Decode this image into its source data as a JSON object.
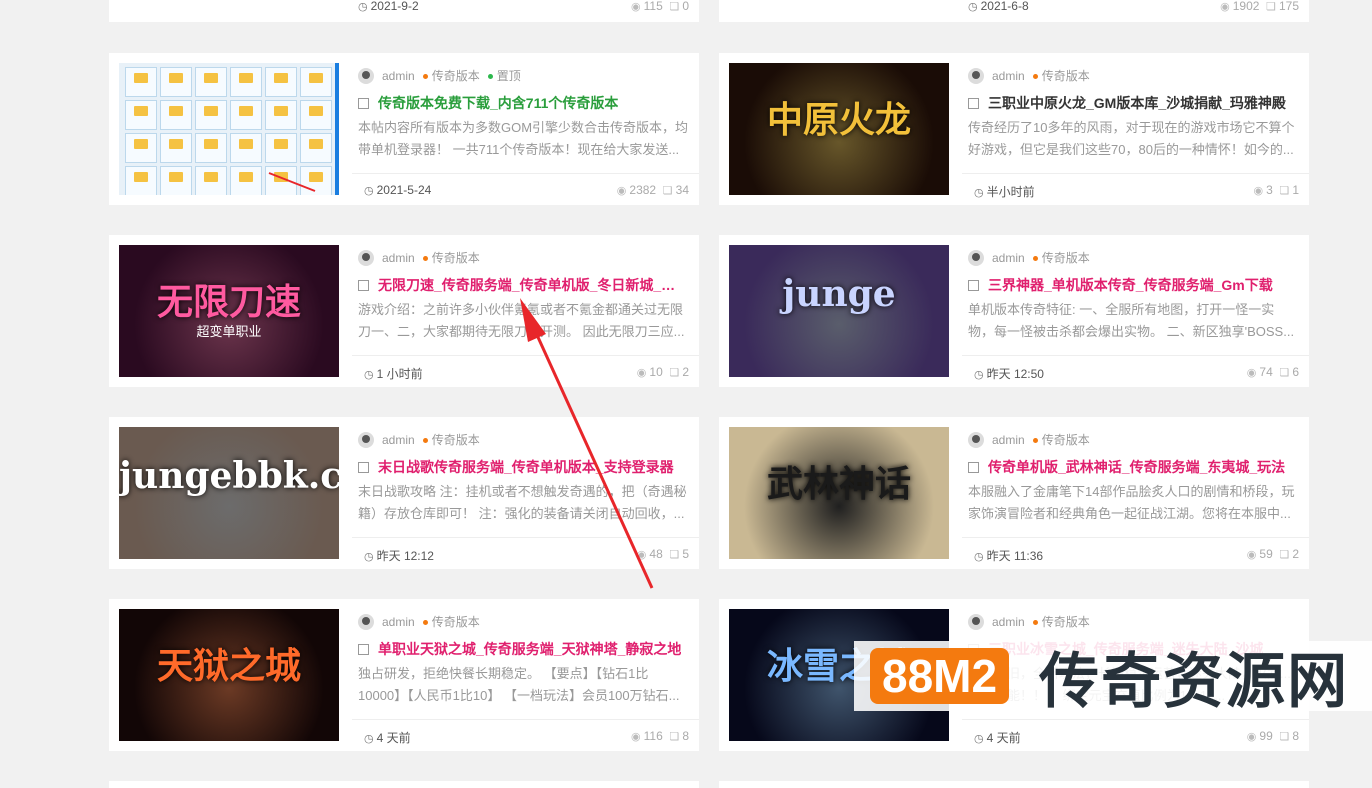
{
  "top_row": [
    {
      "date": "2021-9-2",
      "views": "115",
      "comments": "0"
    },
    {
      "date": "2021-6-8",
      "views": "1902",
      "comments": "175"
    }
  ],
  "posts": [
    {
      "author": "admin",
      "category": "传奇版本",
      "tag": "置顶",
      "tag_color": "#2db84d",
      "title": "传奇版本免费下载_内含711个传奇版本",
      "title_color": "#2a9e3c",
      "excerpt": "本帖内容所有版本为多数GOM引擎少数合击传奇版本，均带单机登录器！ 一共711个传奇版本！现在给大家发送...",
      "date": "2021-5-24",
      "views": "2382",
      "comments": "34",
      "thumb": "folders"
    },
    {
      "author": "admin",
      "category": "传奇版本",
      "title": "三职业中原火龙_GM版本库_沙城捐献_玛雅神殿",
      "title_color": "#333333",
      "excerpt": "传奇经历了10多年的风雨，对于现在的游戏市场它不算个好游戏，但它是我们这些70，80后的一种情怀！如今的...",
      "date": "半小时前",
      "views": "3",
      "comments": "1",
      "thumb_text": "中原火龙",
      "thumb_bg": "#1a0c06",
      "thumb_color": "#f2c03a"
    },
    {
      "author": "admin",
      "category": "传奇版本",
      "title": "无限刀速_传奇服务端_传奇单机版_冬日新城_单职业",
      "title_color": "#e0206e",
      "excerpt": "游戏介绍：之前许多小伙伴氪氪或者不氪金都通关过无限刀一、二，大家都期待无限刀三开测。 因此无限刀三应...",
      "date": "1 小时前",
      "views": "10",
      "comments": "2",
      "thumb_text": "无限刀速",
      "thumb_sub": "超变单职业",
      "thumb_bg": "#2a0a20",
      "thumb_color": "#ff5aa0"
    },
    {
      "author": "admin",
      "category": "传奇版本",
      "title": "三界神器_单机版本传奇_传奇服务端_Gm下载",
      "title_color": "#e0206e",
      "excerpt": "单机版本传奇特征: 一、全服所有地图，打开一怪一实物，每一怪被击杀都会爆出实物。 二、新区独享'BOSS...",
      "date": "昨天 12:50",
      "views": "74",
      "comments": "6",
      "thumb_text": "junge",
      "thumb_bg": "#3a2a5a",
      "thumb_color": "#c9d4ff"
    },
    {
      "author": "admin",
      "category": "传奇版本",
      "title": "末日战歌传奇服务端_传奇单机版本_支持登录器",
      "title_color": "#e0206e",
      "excerpt": "末日战歌攻略 注：挂机或者不想触发奇遇的，把（奇遇秘籍）存放仓库即可！ 注：强化的装备请关闭自动回收，...",
      "date": "昨天 12:12",
      "views": "48",
      "comments": "5",
      "thumb_text": "jungebbk.com",
      "thumb_bg": "#6a5a50",
      "thumb_color": "#ffffff"
    },
    {
      "author": "admin",
      "category": "传奇版本",
      "title": "传奇单机版_武林神话_传奇服务端_东夷城_玩法",
      "title_color": "#e0206e",
      "excerpt": "本服融入了金庸笔下14部作品脍炙人口的剧情和桥段，玩家饰演冒险者和经典角色一起征战江湖。您将在本服中...",
      "date": "昨天 11:36",
      "views": "59",
      "comments": "2",
      "thumb_text": "武林神话",
      "thumb_bg": "#c9b893",
      "thumb_color": "#1a1a1a"
    },
    {
      "author": "admin",
      "category": "传奇版本",
      "title": "单职业天狱之城_传奇服务端_天狱神塔_静寂之地",
      "title_color": "#e0206e",
      "excerpt": "独占研发，拒绝快餐长期稳定。 【要点】【钻石1比10000】【人民币1比10】 【一档玩法】会员100万钻石...",
      "date": "4 天前",
      "views": "116",
      "comments": "8",
      "thumb_text": "天狱之城",
      "thumb_bg": "#120606",
      "thumb_color": "#ff6a2a"
    },
    {
      "author": "admin",
      "category": "传奇版本",
      "title": "三职业冰雪之城_传奇服务端_迷失大陆_沙城",
      "title_color": "#e0206e",
      "excerpt": "经典怀旧，全新玩法，长期稳定运营，迷失大陆，火龙...超不超能！！！ 绑定元宝充值比例为1：10...",
      "date": "4 天前",
      "views": "99",
      "comments": "8",
      "thumb_text": "冰雪之城",
      "thumb_bg": "#06081a",
      "thumb_color": "#7ab8ff"
    }
  ],
  "banner": {
    "badge": "88M2",
    "text": "传奇资源网"
  }
}
